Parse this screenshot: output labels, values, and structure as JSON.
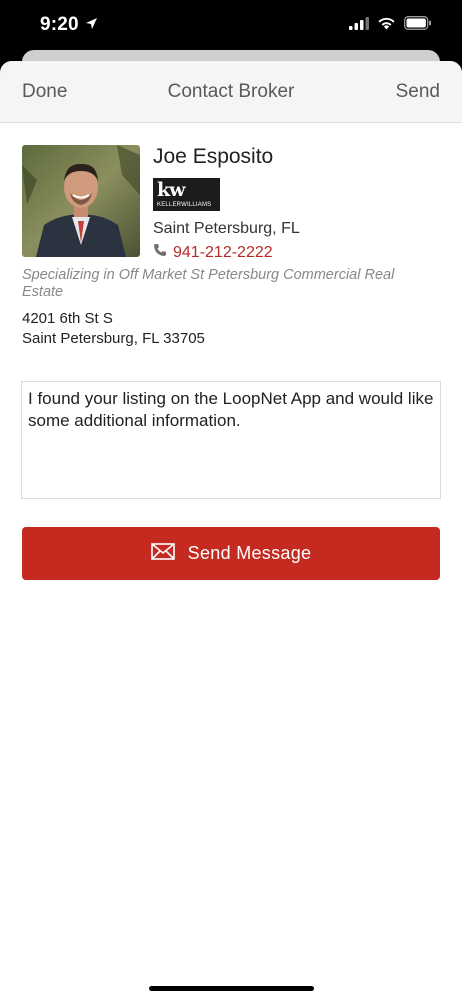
{
  "status_bar": {
    "time": "9:20",
    "icons": [
      "location-arrow-icon",
      "signal-icon",
      "wifi-icon",
      "battery-icon"
    ]
  },
  "nav": {
    "done_label": "Done",
    "title": "Contact Broker",
    "send_label": "Send"
  },
  "broker": {
    "name": "Joe Esposito",
    "brokerage_logo_text": "kw",
    "brokerage_logo_subtext": "KELLERWILLIAMS",
    "city": "Saint Petersburg, FL",
    "phone": "941-212-2222",
    "specialty": "Specializing in Off Market St Petersburg Commercial Real Estate",
    "address_line1": "4201 6th St S",
    "address_line2": "Saint Petersburg, FL 33705"
  },
  "message": {
    "text": "I found your listing on the LoopNet App and would like some additional information."
  },
  "send_message_button": {
    "label": "Send Message"
  },
  "colors": {
    "accent": "#c42a20",
    "phone_link": "#b62b25",
    "nav_background": "#f5f5f5"
  }
}
